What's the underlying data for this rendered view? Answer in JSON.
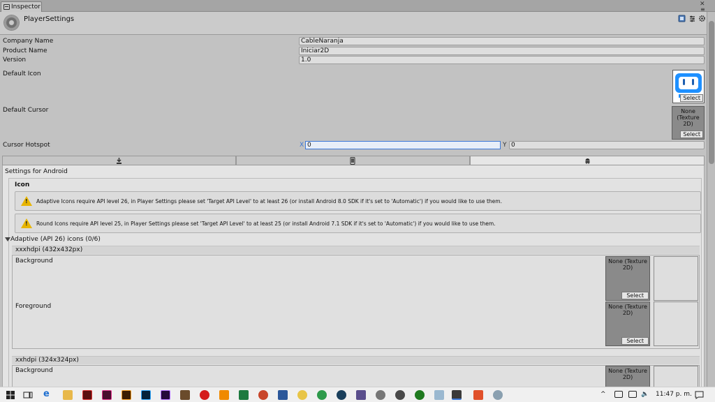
{
  "inspector_tab": {
    "label": "Inspector"
  },
  "header": {
    "title": "PlayerSettings"
  },
  "fields": {
    "company_name": {
      "label": "Company Name",
      "value": "CableNaranja"
    },
    "product_name": {
      "label": "Product Name",
      "value": "Iniciar2D"
    },
    "version": {
      "label": "Version",
      "value": "1.0"
    },
    "default_icon": {
      "label": "Default Icon",
      "select": "Select"
    },
    "default_cursor": {
      "label": "Default Cursor",
      "slot_text": "None (Texture 2D)",
      "select": "Select"
    },
    "cursor_hotspot": {
      "label": "Cursor Hotspot",
      "x_label": "X",
      "x_value": "0",
      "y_label": "Y",
      "y_value": "0"
    }
  },
  "platform_tabs": [
    {
      "name": "standalone",
      "icon": "download-icon",
      "active": false
    },
    {
      "name": "ios",
      "icon": "phone-icon",
      "active": false
    },
    {
      "name": "android",
      "icon": "android-icon",
      "active": true
    }
  ],
  "android": {
    "settings_title": "Settings for Android",
    "icon_section": "Icon",
    "warnings": [
      "Adaptive Icons require API level 26, in Player Settings please set 'Target API Level' to at least 26 (or install Android 8.0 SDK if it's set to 'Automatic') if you would like to use them.",
      "Round Icons require API level 25, in Player Settings please set 'Target API Level' to at least 25 (or install Android 7.1 SDK if it's set to 'Automatic') if you would like to use them."
    ],
    "adaptive_label": "Adaptive (API 26) icons (0/6)",
    "xxxhdpi": {
      "label": "xxxhdpi (432x432px)",
      "background": "Background",
      "foreground": "Foreground"
    },
    "xxhdpi": {
      "label": "xxhdpi (324x324px)",
      "background": "Background"
    },
    "slot_text": "None (Texture 2D)",
    "select": "Select"
  },
  "taskbar": {
    "time": "11:47 p. m."
  },
  "colors": {
    "accent": "#3c78d8",
    "warning": "#e8b500",
    "icon_blue": "#1e90ff"
  }
}
